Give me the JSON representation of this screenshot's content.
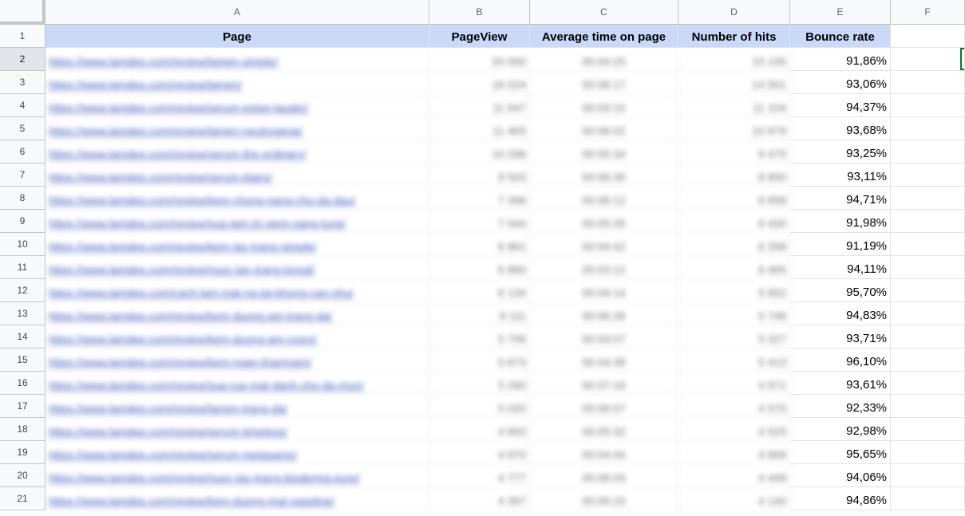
{
  "spreadsheet": {
    "column_letters": [
      "A",
      "B",
      "C",
      "D",
      "E",
      "F"
    ],
    "headers": [
      "Page",
      "PageView",
      "Average time on page",
      "Number of hits",
      "Bounce rate"
    ],
    "rows": [
      {
        "row": "2",
        "page": "https://www.lamdep.com/review/lamen-simple/",
        "pageview": "20 090",
        "avg_time": "00:04:25",
        "hits": "15 155",
        "bounce": "91,86%"
      },
      {
        "row": "3",
        "page": "https://www.lamdep.com/review/lamen/",
        "pageview": "16 024",
        "avg_time": "00:06:17",
        "hits": "14 501",
        "bounce": "93,06%"
      },
      {
        "row": "4",
        "page": "https://www.lamdep.com/review/serum-estee-lauder/",
        "pageview": "11 647",
        "avg_time": "00:03:10",
        "hits": "11 104",
        "bounce": "94,37%"
      },
      {
        "row": "5",
        "page": "https://www.lamdep.com/review/lamen-neutrogena/",
        "pageview": "11 465",
        "avg_time": "00:06:02",
        "hits": "10 879",
        "bounce": "93,68%"
      },
      {
        "row": "6",
        "page": "https://www.lamdep.com/review/serum-the-ordinary/",
        "pageview": "10 298",
        "avg_time": "00:05:34",
        "hits": "9 475",
        "bounce": "93,25%"
      },
      {
        "row": "7",
        "page": "https://www.lamdep.com/review/serum-klairs/",
        "pageview": "9 503",
        "avg_time": "00:06:30",
        "hits": "8 850",
        "bounce": "93,11%"
      },
      {
        "row": "8",
        "page": "https://www.lamdep.com/review/kem-chong-nang-cho-da-dau/",
        "pageview": "7 398",
        "avg_time": "00:06:12",
        "hits": "6 858",
        "bounce": "94,71%"
      },
      {
        "row": "9",
        "page": "https://www.lamdep.com/review/sua-tam-tri-viem-nang-lung/",
        "pageview": "7 044",
        "avg_time": "00:05:35",
        "hits": "6 430",
        "bounce": "91,98%"
      },
      {
        "row": "10",
        "page": "https://www.lamdep.com/review/kem-tay-trang-simple/",
        "pageview": "6 861",
        "avg_time": "00:04:42",
        "hits": "6 358",
        "bounce": "91,19%"
      },
      {
        "row": "11",
        "page": "https://www.lamdep.com/review/nuoc-tay-trang-loreal/",
        "pageview": "6 860",
        "avg_time": "00:03:12",
        "hits": "6 465",
        "bounce": "94,11%"
      },
      {
        "row": "12",
        "page": "https://www.lamdep.com/cach-lam-mat-na-tai-khong-can-nhu/",
        "pageview": "6 134",
        "avg_time": "00:04:14",
        "hits": "5 852",
        "bounce": "95,70%"
      },
      {
        "row": "13",
        "page": "https://www.lamdep.com/review/kem-duong-am-trang-da/",
        "pageview": "6 111",
        "avg_time": "00:06:26",
        "hits": "5 746",
        "bounce": "94,83%"
      },
      {
        "row": "14",
        "page": "https://www.lamdep.com/review/kem-duong-am-cosrx/",
        "pageview": "5 756",
        "avg_time": "00:03:07",
        "hits": "5 327",
        "bounce": "93,71%"
      },
      {
        "row": "15",
        "page": "https://www.lamdep.com/review/kem-ngan-thamnam/",
        "pageview": "5 673",
        "avg_time": "00:04:38",
        "hits": "5 413",
        "bounce": "96,10%"
      },
      {
        "row": "16",
        "page": "https://www.lamdep.com/review/sua-rua-mat-danh-cho-da-mun/",
        "pageview": "5 290",
        "avg_time": "00:07:16",
        "hits": "4 971",
        "bounce": "93,61%"
      },
      {
        "row": "17",
        "page": "https://www.lamdep.com/review/lamen-trang-da/",
        "pageview": "5 020",
        "avg_time": "00:06:07",
        "hits": "4 575",
        "bounce": "92,33%"
      },
      {
        "row": "18",
        "page": "https://www.lamdep.com/review/serum-timeless/",
        "pageview": "4 893",
        "avg_time": "00:05:32",
        "hits": "4 525",
        "bounce": "92,98%"
      },
      {
        "row": "19",
        "page": "https://www.lamdep.com/review/serum-melaganix/",
        "pageview": "4 870",
        "avg_time": "00:04:44",
        "hits": "4 669",
        "bounce": "95,65%"
      },
      {
        "row": "20",
        "page": "https://www.lamdep.com/review/nuoc-tay-trang-bioderma-pure/",
        "pageview": "4 777",
        "avg_time": "00:06:03",
        "hits": "4 449",
        "bounce": "94,06%"
      },
      {
        "row": "21",
        "page": "https://www.lamdep.com/review/kem-duong-mat-vaseline/",
        "pageview": "4 397",
        "avg_time": "00:05:23",
        "hits": "4 140",
        "bounce": "94,86%"
      }
    ]
  }
}
